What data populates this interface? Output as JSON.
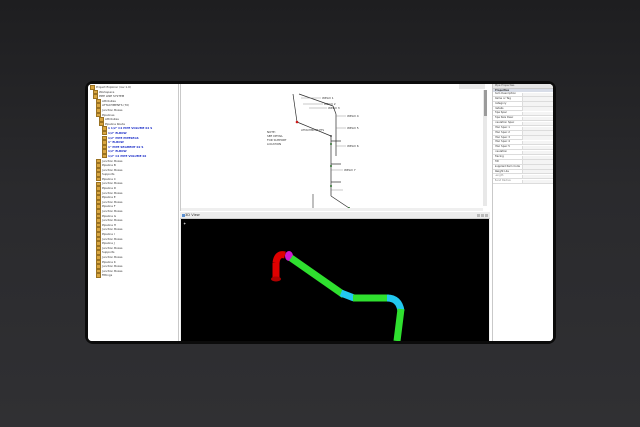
{
  "tree": {
    "rows": [
      {
        "label": "Project Explorer (rev 1.0)",
        "indent": 0,
        "selected": false
      },
      {
        "label": "Workspace",
        "indent": 1,
        "selected": false
      },
      {
        "label": "PIPE LINE SYSTEM",
        "indent": 1,
        "selected": false
      },
      {
        "label": "Attributes",
        "indent": 2,
        "selected": false
      },
      {
        "label": "ATTACHMENTS (70)",
        "indent": 2,
        "selected": false
      },
      {
        "label": "Junction Boxes",
        "indent": 2,
        "selected": false
      },
      {
        "label": "Pipelines",
        "indent": 2,
        "selected": false
      },
      {
        "label": "Attributes",
        "indent": 3,
        "selected": false
      },
      {
        "label": "Pipeline Route",
        "indent": 3,
        "selected": false
      },
      {
        "label": "1 1/2\" C2 PIPE VOLUME 02 S",
        "indent": 4,
        "selected": true
      },
      {
        "label": "1/2\" ELBOW",
        "indent": 4,
        "selected": true
      },
      {
        "label": "1/2\" PIPE PIPESEGS",
        "indent": 4,
        "selected": true
      },
      {
        "label": "1\" ELBOW",
        "indent": 4,
        "selected": true
      },
      {
        "label": "1\" PIPE SEGMENT 02 S",
        "indent": 4,
        "selected": true
      },
      {
        "label": "1/2\" ELBOW",
        "indent": 4,
        "selected": true
      },
      {
        "label": "1/2\" C2 PIPE VOLUME 02",
        "indent": 4,
        "selected": true
      },
      {
        "label": "Junction Boxes",
        "indent": 2,
        "selected": false
      },
      {
        "label": "Pipeline B",
        "indent": 2,
        "selected": false
      },
      {
        "label": "Junction Boxes",
        "indent": 2,
        "selected": false
      },
      {
        "label": "Supports",
        "indent": 2,
        "selected": false
      },
      {
        "label": "Pipeline C",
        "indent": 2,
        "selected": false
      },
      {
        "label": "Junction Boxes",
        "indent": 2,
        "selected": false
      },
      {
        "label": "Pipeline D",
        "indent": 2,
        "selected": false
      },
      {
        "label": "Junction Boxes",
        "indent": 2,
        "selected": false
      },
      {
        "label": "Pipeline E",
        "indent": 2,
        "selected": false
      },
      {
        "label": "Junction Boxes",
        "indent": 2,
        "selected": false
      },
      {
        "label": "Pipeline F",
        "indent": 2,
        "selected": false
      },
      {
        "label": "Junction Boxes",
        "indent": 2,
        "selected": false
      },
      {
        "label": "Pipeline G",
        "indent": 2,
        "selected": false
      },
      {
        "label": "Junction Boxes",
        "indent": 2,
        "selected": false
      },
      {
        "label": "Pipeline H",
        "indent": 2,
        "selected": false
      },
      {
        "label": "Junction Boxes",
        "indent": 2,
        "selected": false
      },
      {
        "label": "Pipeline I",
        "indent": 2,
        "selected": false
      },
      {
        "label": "Junction Boxes",
        "indent": 2,
        "selected": false
      },
      {
        "label": "Pipeline J",
        "indent": 2,
        "selected": false
      },
      {
        "label": "Junction Boxes",
        "indent": 2,
        "selected": false
      },
      {
        "label": "Supports",
        "indent": 2,
        "selected": false
      },
      {
        "label": "Junction Boxes",
        "indent": 2,
        "selected": false
      },
      {
        "label": "Pipeline K",
        "indent": 2,
        "selected": false
      },
      {
        "label": "Junction Boxes",
        "indent": 2,
        "selected": false
      },
      {
        "label": "Junction Boxes",
        "indent": 2,
        "selected": false
      },
      {
        "label": "Fittings",
        "indent": 2,
        "selected": false
      }
    ]
  },
  "iso_view": {
    "labels": [
      "WELD 1",
      "WELD 2",
      "WELD 3",
      "WELD 4",
      "WELD 5",
      "WELD 6",
      "WELD 7"
    ],
    "note_lines": [
      "NOTE:",
      "SEE DETAIL",
      "FOR SUPPORT",
      "LOCATION"
    ],
    "callout": "ATTACHMENT PTS"
  },
  "view3d": {
    "title": "3D View",
    "pipe_colors": {
      "red": "#e00000",
      "magenta": "#d018d0",
      "green": "#2fe02f",
      "cyan": "#22c8f0"
    }
  },
  "properties": {
    "header": "Pipe Properties",
    "section": "Properties",
    "rows": [
      {
        "name": "Item Description",
        "disabled": false
      },
      {
        "name": "Name or Tag",
        "disabled": false
      },
      {
        "name": "Category",
        "disabled": false
      },
      {
        "name": "Details",
        "disabled": false
      },
      {
        "name": "Pipe Spec",
        "disabled": false
      },
      {
        "name": "Pipe Size Desc",
        "disabled": false
      },
      {
        "name": "Insulation Spec",
        "disabled": false
      },
      {
        "name": "Misc Spec 1",
        "disabled": false
      },
      {
        "name": "Misc Spec 2",
        "disabled": false
      },
      {
        "name": "Misc Spec 3",
        "disabled": false
      },
      {
        "name": "Misc Spec 4",
        "disabled": false
      },
      {
        "name": "Misc Spec 5",
        "disabled": false
      },
      {
        "name": "Insulation",
        "disabled": false
      },
      {
        "name": "Tracing",
        "disabled": false
      },
      {
        "name": "PID",
        "disabled": false
      },
      {
        "name": "Supplied Item Code",
        "disabled": false
      },
      {
        "name": "Weight Lbs",
        "disabled": false
      },
      {
        "name": "Length",
        "disabled": true
      },
      {
        "name": "Bend Radius",
        "disabled": true
      }
    ]
  }
}
